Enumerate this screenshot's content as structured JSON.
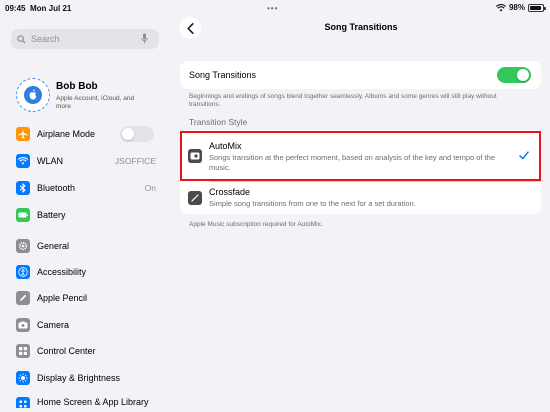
{
  "status_bar": {
    "time": "09:45",
    "date": "Mon Jul 21",
    "dots": "•••",
    "battery": "98%"
  },
  "sidebar": {
    "search_placeholder": "Search",
    "profile": {
      "name": "Bob Bob",
      "subtitle": "Apple Account, iCloud, and more"
    },
    "items": [
      {
        "label": "Airplane Mode",
        "icon": "airplane-icon",
        "color": "#ff9500",
        "control": "toggle"
      },
      {
        "label": "WLAN",
        "icon": "wifi-icon",
        "color": "#007aff",
        "value": "JSOFFICE"
      },
      {
        "label": "Bluetooth",
        "icon": "bluetooth-icon",
        "color": "#007aff",
        "value": "On"
      },
      {
        "label": "Battery",
        "icon": "battery-icon",
        "color": "#34c759"
      },
      {
        "label": "General",
        "icon": "gear-icon",
        "color": "#8e8e93"
      },
      {
        "label": "Accessibility",
        "icon": "accessibility-icon",
        "color": "#007aff"
      },
      {
        "label": "Apple Pencil",
        "icon": "pencil-icon",
        "color": "#8e8e93"
      },
      {
        "label": "Camera",
        "icon": "camera-icon",
        "color": "#8e8e93"
      },
      {
        "label": "Control Center",
        "icon": "control-center-icon",
        "color": "#8e8e93"
      },
      {
        "label": "Display & Brightness",
        "icon": "brightness-icon",
        "color": "#007aff"
      },
      {
        "label": "Home Screen & App Library",
        "icon": "home-screen-icon",
        "color": "#007aff"
      }
    ]
  },
  "main": {
    "title": "Song Transitions",
    "toggle_label": "Song Transitions",
    "toggle_on": true,
    "toggle_footnote": "Beginnings and endings of songs blend together seamlessly. Albums and some genres will still play without transitions.",
    "section_header": "Transition Style",
    "options": [
      {
        "title": "AutoMix",
        "description": "Songs transition at the perfect moment, based on analysis of the key and tempo of the music.",
        "selected": true
      },
      {
        "title": "Crossfade",
        "description": "Simple song transitions from one to the next for a set duration.",
        "selected": false
      }
    ],
    "options_footnote": "Apple Music subscription required for AutoMix."
  },
  "colors": {
    "accent": "#007aff",
    "toggle_on": "#34c759",
    "highlight": "#e8131d"
  }
}
